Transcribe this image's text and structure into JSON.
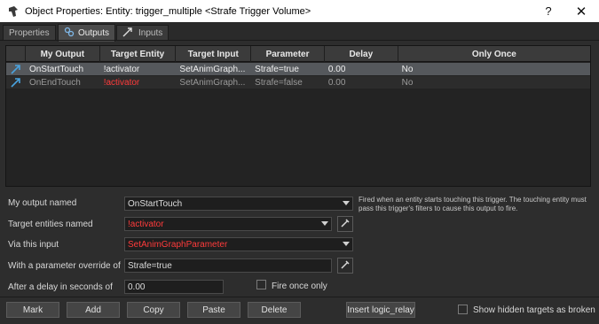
{
  "window": {
    "title": "Object Properties: Entity: trigger_multiple <Strafe Trigger Volume>",
    "help": "?",
    "close": "✕"
  },
  "tabs": [
    {
      "label": "Properties"
    },
    {
      "label": "Outputs"
    },
    {
      "label": "Inputs"
    }
  ],
  "table": {
    "columns": [
      "My Output",
      "Target Entity",
      "Target Input",
      "Parameter",
      "Delay",
      "Only Once"
    ],
    "rows": [
      {
        "output": "OnStartTouch",
        "target": "!activator",
        "input": "SetAnimGraph...",
        "param": "Strafe=true",
        "delay": "0.00",
        "once": "No"
      },
      {
        "output": "OnEndTouch",
        "target": "!activator",
        "input": "SetAnimGraph...",
        "param": "Strafe=false",
        "delay": "0.00",
        "once": "No"
      }
    ]
  },
  "form": {
    "output_label": "My output named",
    "output_value": "OnStartTouch",
    "target_label": "Target entities named",
    "target_value": "!activator",
    "input_label": "Via this input",
    "input_value": "SetAnimGraphParameter",
    "param_label": "With a parameter override of",
    "param_value": "Strafe=true",
    "delay_label": "After a delay in seconds of",
    "delay_value": "0.00",
    "fire_once_label": "Fire once only",
    "description": "Fired when an entity starts touching this trigger. The touching entity must pass this trigger's filters to cause this output to fire."
  },
  "buttons": {
    "mark": "Mark",
    "add": "Add",
    "copy": "Copy",
    "paste": "Paste",
    "delete": "Delete",
    "insert_relay": "Insert logic_relay",
    "show_hidden": "Show hidden targets as broken"
  },
  "colors": {
    "accent_red": "#ff3b3b",
    "selection": "#55585c",
    "io_icon": "#4aa3df"
  }
}
